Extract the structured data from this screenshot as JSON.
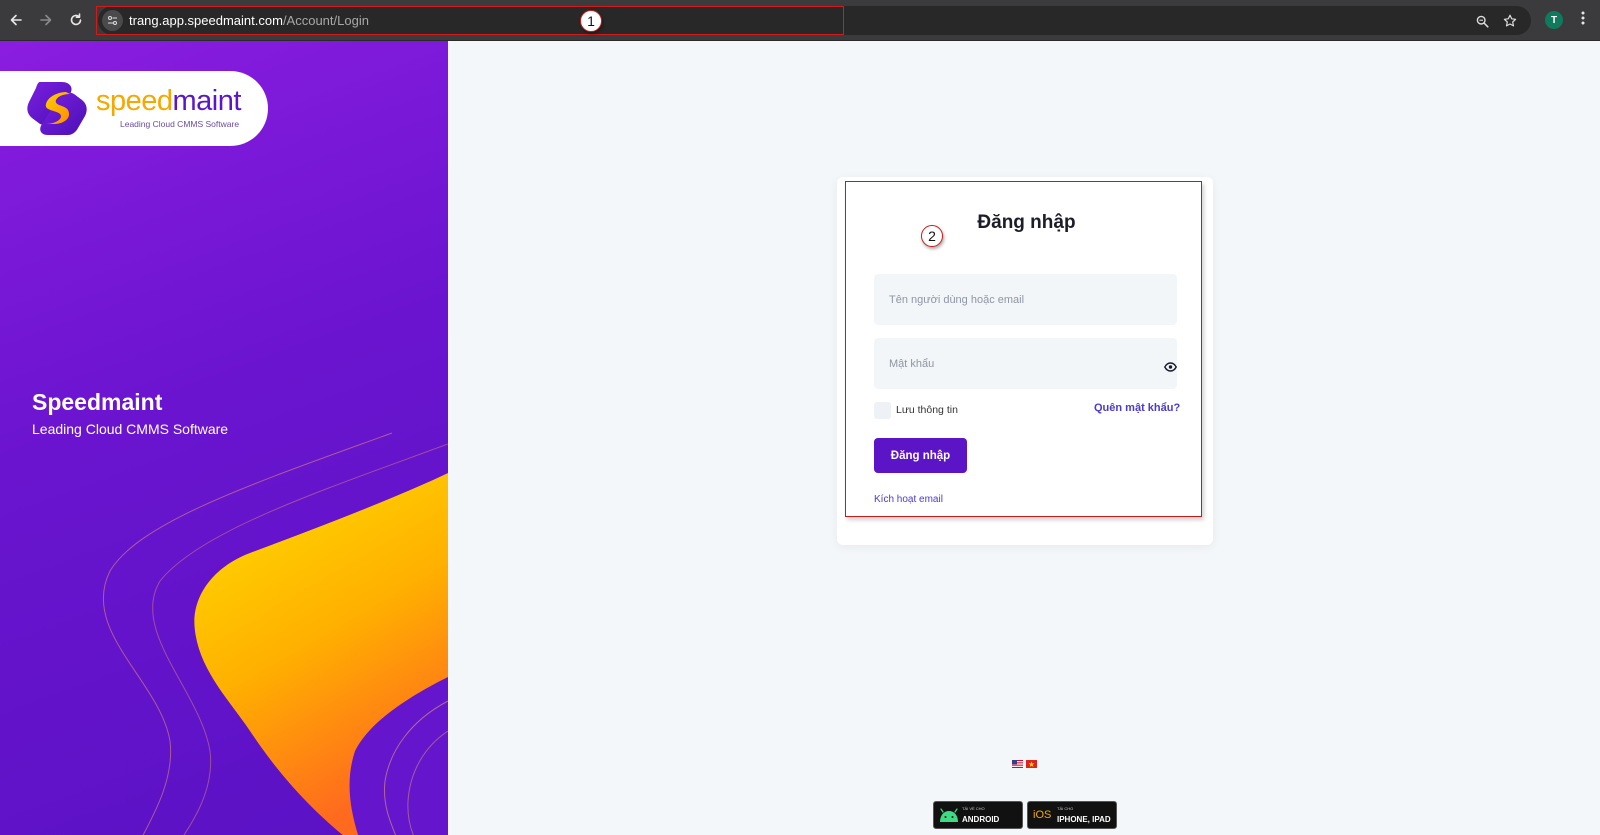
{
  "browser": {
    "url_host": "trang.app.speedmaint.com",
    "url_path": "/Account/Login",
    "profile_initial": "T",
    "icons": [
      "back-arrow-icon",
      "forward-arrow-icon",
      "reload-icon",
      "site-info-icon",
      "zoom-icon",
      "bookmark-star-icon",
      "kebab-menu-icon"
    ]
  },
  "annotations": {
    "badge_1": "1",
    "badge_2": "2"
  },
  "brand": {
    "logo_word_a": "speed",
    "logo_word_b": "maint",
    "logo_tagline": "Leading Cloud CMMS Software",
    "title": "Speedmaint",
    "subtitle": "Leading Cloud CMMS Software"
  },
  "login": {
    "title": "Đăng nhập",
    "username_placeholder": "Tên người dùng hoặc email",
    "username_value": "",
    "password_placeholder": "Mật khẩu",
    "password_value": "",
    "remember_label": "Lưu thông tin",
    "remember_checked": false,
    "forgot_label": "Quên mật khẩu?",
    "submit_label": "Đăng nhập",
    "activate_label": "Kích hoạt email"
  },
  "apps": {
    "android_small": "TẢI VỀ CHO",
    "android_big": "ANDROID",
    "ios_mark": "iOS",
    "ios_small": "TẢI CHO",
    "ios_big": "IPHONE, IPAD"
  },
  "colors": {
    "brand_purple": "#5b15c7",
    "brand_yellow": "#f6a800",
    "link": "#4b3ad2",
    "annotation_red": "#d11a1a"
  }
}
